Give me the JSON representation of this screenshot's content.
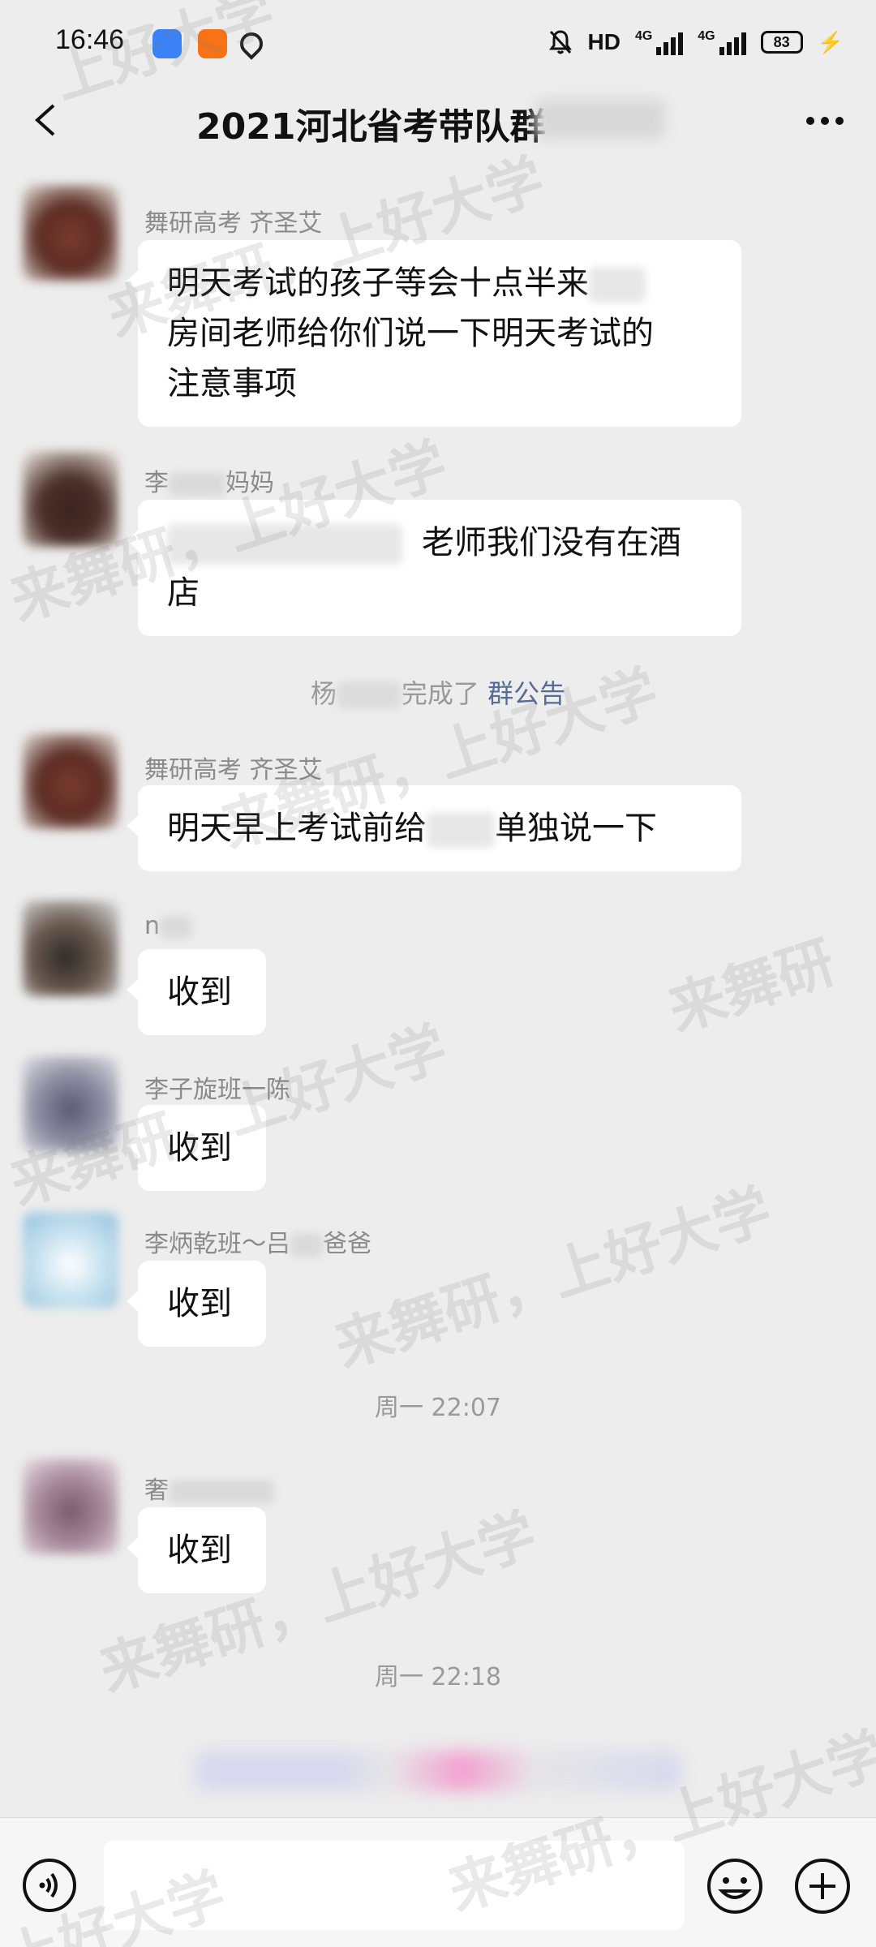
{
  "status_bar": {
    "time": "16:46",
    "hd_label": "HD",
    "signal_label_1": "4G",
    "signal_label_2": "4G",
    "battery": "83"
  },
  "nav": {
    "title": "2021河北省考带队群"
  },
  "messages": [
    {
      "sender": "舞研高考 齐圣艾",
      "text_parts": [
        "明天考试的孩子等会十点半来",
        "房间老师给你们说一下明天考试的",
        "注意事项"
      ]
    },
    {
      "sender_prefix": "李",
      "sender_suffix": "妈妈",
      "text_parts": [
        "老师我们没有在酒",
        "店"
      ]
    },
    {
      "sender": "舞研高考 齐圣艾",
      "text_before": "明天早上考试前给",
      "text_after": "单独说一下"
    },
    {
      "sender": "n",
      "text": "收到"
    },
    {
      "sender": "李子旋班一陈",
      "text": "收到"
    },
    {
      "sender_prefix": "李炳乾班～吕",
      "sender_suffix": "爸爸",
      "text": "收到"
    },
    {
      "sender": "奢",
      "text": "收到"
    }
  ],
  "system_notice": {
    "prefix": "杨",
    "middle": "完成了",
    "link": "群公告"
  },
  "time_dividers": [
    "周一 22:07",
    "周一 22:18"
  ],
  "input": {
    "placeholder": ""
  },
  "watermark": {
    "text_1": "上好大学",
    "text_2": "来舞研，上好大学",
    "text_3": "来舞研"
  },
  "colors": {
    "background": "#ededed",
    "bubble": "#ffffff",
    "link": "#576b95"
  }
}
